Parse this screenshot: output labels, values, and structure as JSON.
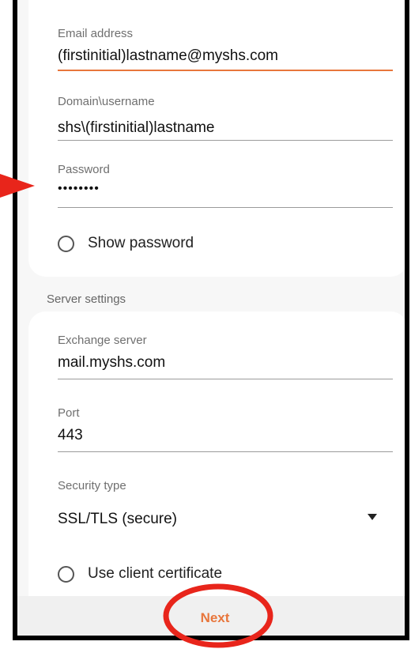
{
  "account": {
    "email": {
      "label": "Email address",
      "value": "(firstinitial)lastname@myshs.com"
    },
    "username": {
      "label": "Domain\\username",
      "value": "shs\\(firstinitial)lastname"
    },
    "password": {
      "label": "Password",
      "value": "••••••••"
    },
    "show_password_label": "Show password"
  },
  "server": {
    "section_title": "Server settings",
    "exchange": {
      "label": "Exchange server",
      "value": "mail.myshs.com"
    },
    "port": {
      "label": "Port",
      "value": "443"
    },
    "security": {
      "label": "Security type",
      "value": "SSL/TLS (secure)"
    },
    "client_cert_label": "Use client certificate"
  },
  "footer": {
    "next_label": "Next"
  },
  "colors": {
    "accent": "#e8763c",
    "annotation_red": "#e8251b"
  }
}
